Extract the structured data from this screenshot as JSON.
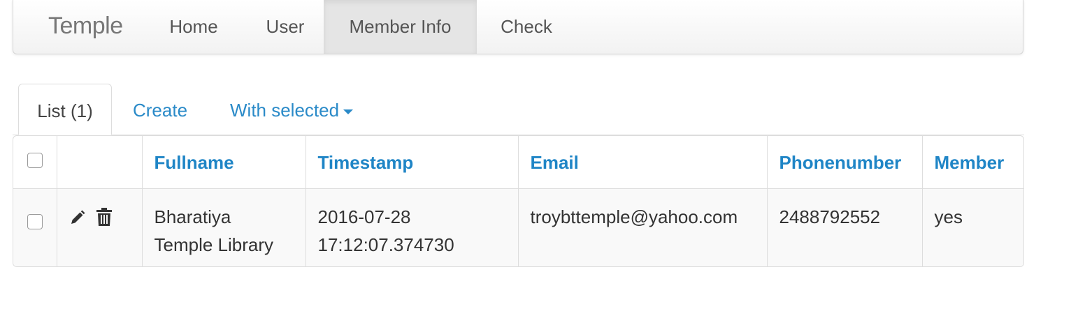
{
  "navbar": {
    "brand": "Temple",
    "items": [
      {
        "label": "Home"
      },
      {
        "label": "User"
      },
      {
        "label": "Member Info"
      },
      {
        "label": "Check"
      }
    ]
  },
  "tabs": {
    "list_label": "List (1)",
    "create_label": "Create",
    "with_selected_label": "With selected"
  },
  "table": {
    "columns": [
      "Fullname",
      "Timestamp",
      "Email",
      "Phonenumber",
      "Member"
    ],
    "rows": [
      {
        "fullname_line1": "Bharatiya",
        "fullname_line2": "Temple Library",
        "timestamp_line1": "2016-07-28",
        "timestamp_line2": "17:12:07.374730",
        "email": "troybttemple@yahoo.com",
        "phonenumber": "2488792552",
        "member": "yes"
      }
    ]
  },
  "icons": {
    "edit": "pencil-icon",
    "delete": "trash-icon",
    "dropdown": "caret-down-icon"
  },
  "colors": {
    "link": "#2a8ac8",
    "header_link": "#1f85c6",
    "active_nav_bg": "#e5e5e5"
  }
}
